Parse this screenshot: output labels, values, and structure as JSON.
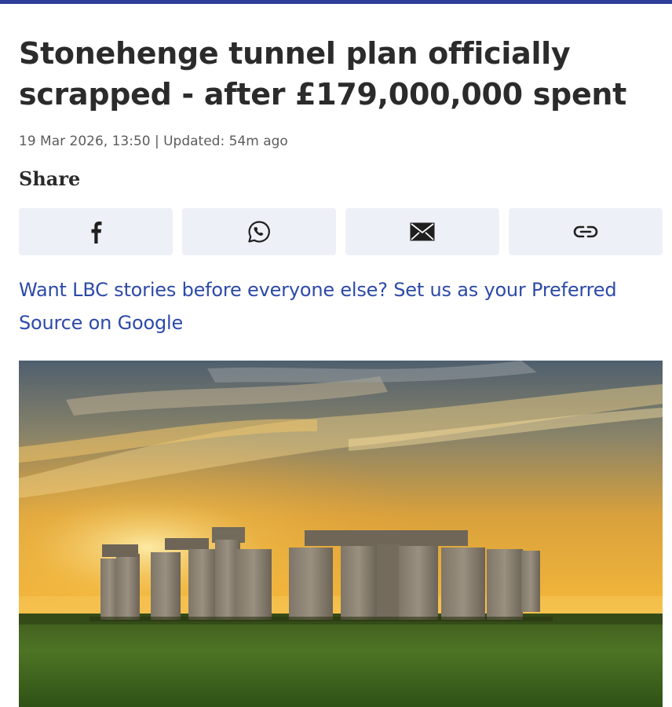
{
  "article": {
    "headline": "Stonehenge tunnel plan officially scrapped - after £179,000,000 spent",
    "meta": "19 Mar 2026, 13:50 | Updated: 54m ago"
  },
  "share": {
    "label": "Share",
    "buttons": [
      {
        "icon": "facebook-icon"
      },
      {
        "icon": "whatsapp-icon"
      },
      {
        "icon": "email-icon"
      },
      {
        "icon": "link-icon"
      }
    ]
  },
  "cta": {
    "text": "Want LBC stories before everyone else? Set us as your Preferred Source on Google"
  },
  "colors": {
    "brand": "#2d3f9b",
    "link": "#2d4aa8",
    "share_bg": "#eef0f7"
  }
}
